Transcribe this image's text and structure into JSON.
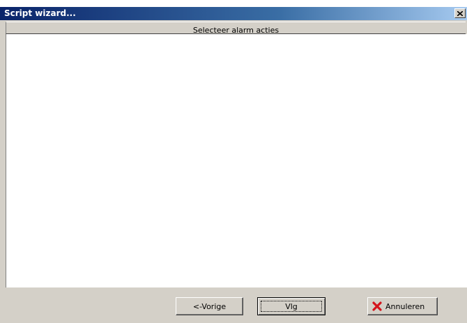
{
  "window": {
    "title": "Script wizard..."
  },
  "header": {
    "text": "Selecteer alarm acties"
  },
  "buttons": {
    "prev_label": "<-Vorige",
    "next_label": "Vlg",
    "cancel_label": "Annuleren"
  },
  "icons": {
    "close": "close-icon",
    "cancel": "red-x-icon"
  },
  "colors": {
    "titlebar_start": "#0a246a",
    "titlebar_end": "#a6caf0",
    "dialog_face": "#d4d0c8",
    "cancel_icon": "#d4141c"
  }
}
